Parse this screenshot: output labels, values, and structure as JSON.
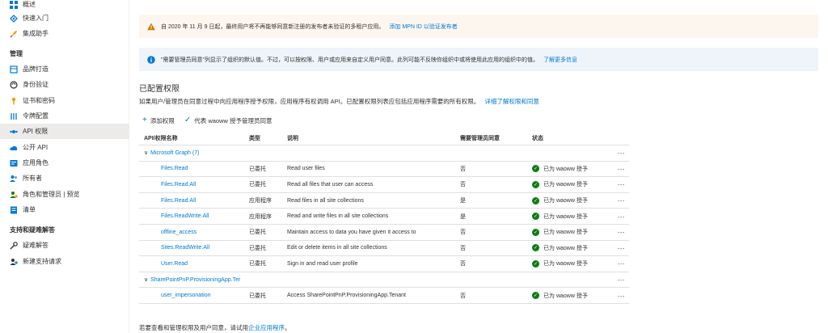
{
  "sidebar": {
    "items_top": [
      {
        "label": "概述",
        "icon": "overview-icon"
      },
      {
        "label": "快速入门",
        "icon": "quickstart-icon"
      },
      {
        "label": "集成助手",
        "icon": "rocket-icon"
      }
    ],
    "manage_header": "管理",
    "manage_items": [
      {
        "label": "品牌打造",
        "icon": "branding-icon"
      },
      {
        "label": "身份验证",
        "icon": "authentication-icon"
      },
      {
        "label": "证书和密码",
        "icon": "key-icon"
      },
      {
        "label": "令牌配置",
        "icon": "token-icon"
      },
      {
        "label": "API 权限",
        "icon": "api-permissions-icon"
      },
      {
        "label": "公开 API",
        "icon": "cloud-icon"
      },
      {
        "label": "应用角色",
        "icon": "app-roles-icon"
      },
      {
        "label": "所有者",
        "icon": "owners-icon"
      },
      {
        "label": "角色和管理员 | 预览",
        "icon": "roles-admins-icon"
      },
      {
        "label": "清单",
        "icon": "manifest-icon"
      }
    ],
    "support_header": "支持和疑难解答",
    "support_items": [
      {
        "label": "疑难解答",
        "icon": "wrench-icon"
      },
      {
        "label": "新建支持请求",
        "icon": "support-request-icon"
      }
    ]
  },
  "banners": {
    "warning_text": "自 2020 年 11 月 9 日起，最终用户将不再能够同意新注册的发布者未验证的多租户应用。",
    "warning_link": "添加 MPN ID 以验证发布者",
    "info_text": "\"需要管理员同意\"列显示了组织的默认值。不过，可以按权限、用户或应用来自定义用户同意。此列可能不反映你组织中或将使用此应用的组织中的值。",
    "info_link": "了解更多信息"
  },
  "section": {
    "title": "已配置权限",
    "description": "如果用户/管理员在同意过程中向应用程序授予权限，应用程序有权调用 API。已配置权限列表应包括应用程序需要的所有权限。",
    "description_link": "详细了解权限和同意"
  },
  "toolbar": {
    "add_permission": "添加权限",
    "grant_consent": "代表 waoww 授予管理员同意"
  },
  "table": {
    "headers": {
      "name": "API/权限名称",
      "type": "类型",
      "description": "说明",
      "admin_consent": "需要管理员同意",
      "status": "状态"
    },
    "groups": [
      {
        "label": "Microsoft Graph (7)",
        "rows": [
          {
            "name": "Files.Read",
            "type": "已委托",
            "description": "Read user files",
            "admin": "否",
            "status": "已为 waoww 授予"
          },
          {
            "name": "Files.Read.All",
            "type": "已委托",
            "description": "Read all files that user can access",
            "admin": "否",
            "status": "已为 waoww 授予"
          },
          {
            "name": "Files.Read.All",
            "type": "应用程序",
            "description": "Read files in all site collections",
            "admin": "是",
            "status": "已为 waoww 授予"
          },
          {
            "name": "Files.ReadWrite.All",
            "type": "应用程序",
            "description": "Read and write files in all site collections",
            "admin": "是",
            "status": "已为 waoww 授予"
          },
          {
            "name": "offline_access",
            "type": "已委托",
            "description": "Maintain access to data you have given it access to",
            "admin": "否",
            "status": "已为 waoww 授予"
          },
          {
            "name": "Sites.ReadWrite.All",
            "type": "已委托",
            "description": "Edit or delete items in all site collections",
            "admin": "否",
            "status": "已为 waoww 授予"
          },
          {
            "name": "User.Read",
            "type": "已委托",
            "description": "Sign in and read user profile",
            "admin": "否",
            "status": "已为 waoww 授予"
          }
        ]
      },
      {
        "label": "SharePointPnP.ProvisioningApp.Ter",
        "rows": [
          {
            "name": "user_impersonation",
            "type": "已委托",
            "description": "Access SharePointPnP.ProvisioningApp.Tenant",
            "admin": "否",
            "status": "已为 waoww 授予"
          }
        ]
      }
    ],
    "more_label": "···"
  },
  "footer": {
    "text": "若要查看和管理权限及用户同意，请试用",
    "link": "企业应用程序",
    "suffix": "。"
  },
  "colors": {
    "accent": "#0078d4",
    "success": "#107c10",
    "warning": "#d47500",
    "active_nav": "#edebe9"
  }
}
